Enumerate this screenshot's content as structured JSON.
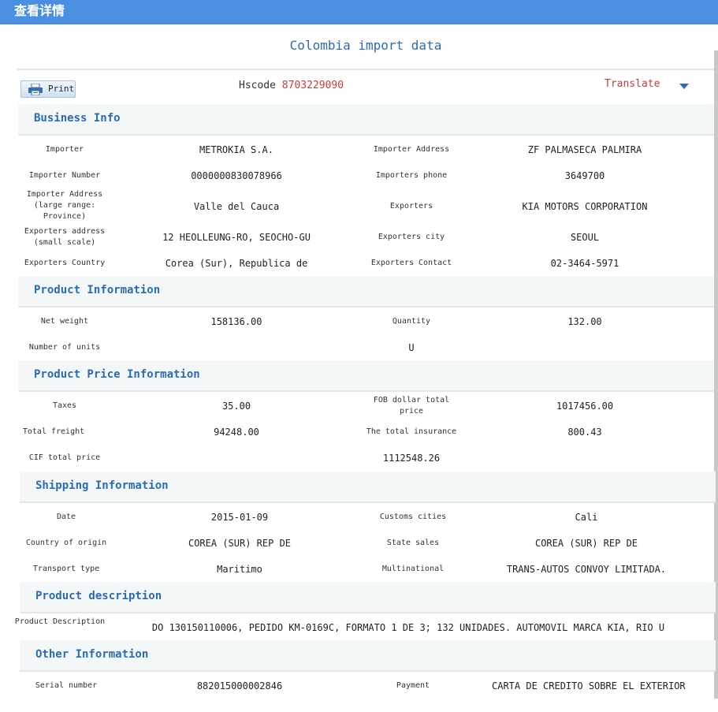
{
  "window": {
    "title": "查看详情"
  },
  "page_title": "Colombia import data",
  "toolbar": {
    "print_label": "Print",
    "hscode_label": "Hscode",
    "hscode_value": "8703229090",
    "translate_label": "Translate"
  },
  "sections": {
    "business": {
      "title": "Business Info",
      "importer_label": "Importer",
      "importer_value": "METROKIA S.A.",
      "importer_address_label": "Importer Address",
      "importer_address_value": "ZF PALMASECA PALMIRA",
      "importer_number_label": "Importer Number",
      "importer_number_value": "0000000830078966",
      "importers_phone_label": "Importers phone",
      "importers_phone_value": "3649700",
      "importer_address_large_label": "Importer Address (large range: Province)",
      "importer_address_large_value": "Valle del Cauca",
      "exporters_label": "Exporters",
      "exporters_value": "KIA MOTORS CORPORATION",
      "exporters_address_label": "Exporters address (small scale)",
      "exporters_address_value": "12 HEOLLEUNG-RO, SEOCHO-GU",
      "exporters_city_label": "Exporters city",
      "exporters_city_value": "SEOUL",
      "exporters_country_label": "Exporters Country",
      "exporters_country_value": "Corea (Sur), Republica de",
      "exporters_contact_label": "Exporters Contact",
      "exporters_contact_value": "02-3464-5971"
    },
    "product": {
      "title": "Product Information",
      "net_weight_label": "Net weight",
      "net_weight_value": "158136.00",
      "quantity_label": "Quantity",
      "quantity_value": "132.00",
      "units_label": "Number of units",
      "units_value": "U"
    },
    "price": {
      "title": "Product Price Information",
      "taxes_label": "Taxes",
      "taxes_value": "35.00",
      "fob_label": "FOB dollar total price",
      "fob_value": "1017456.00",
      "freight_label": "Total freight",
      "freight_value": "94248.00",
      "insurance_label": "The total insurance",
      "insurance_value": "800.43",
      "cif_label": "CIF total price",
      "cif_value": "1112548.26"
    },
    "shipping": {
      "title": "Shipping Information",
      "date_label": "Date",
      "date_value": "2015-01-09",
      "customs_label": "Customs cities",
      "customs_value": "Cali",
      "origin_label": "Country of origin",
      "origin_value": "COREA (SUR) REP DE",
      "state_label": "State sales",
      "state_value": "COREA (SUR) REP DE",
      "transport_label": "Transport type",
      "transport_value": "Maritimo",
      "multinational_label": "Multinational",
      "multinational_value": "TRANS-AUTOS CONVOY LIMITADA."
    },
    "description": {
      "title": "Product description",
      "desc_label": "Product Description",
      "desc_value": "DO 130150110006, PEDIDO KM-0169C, FORMATO 1 DE 3; 132 UNIDADES. AUTOMOVIL MARCA KIA, RIO U"
    },
    "other": {
      "title": "Other Information",
      "serial_label": "Serial number",
      "serial_value": "882015000002846",
      "payment_label": "Payment",
      "payment_value": "CARTA DE CREDITO SOBRE EL EXTERIOR"
    }
  },
  "colors": {
    "accent": "#2b6bb5",
    "titlebar": "#4a8fe2",
    "highlight": "#d23a3a",
    "section_bg": "#f4f7f7"
  }
}
